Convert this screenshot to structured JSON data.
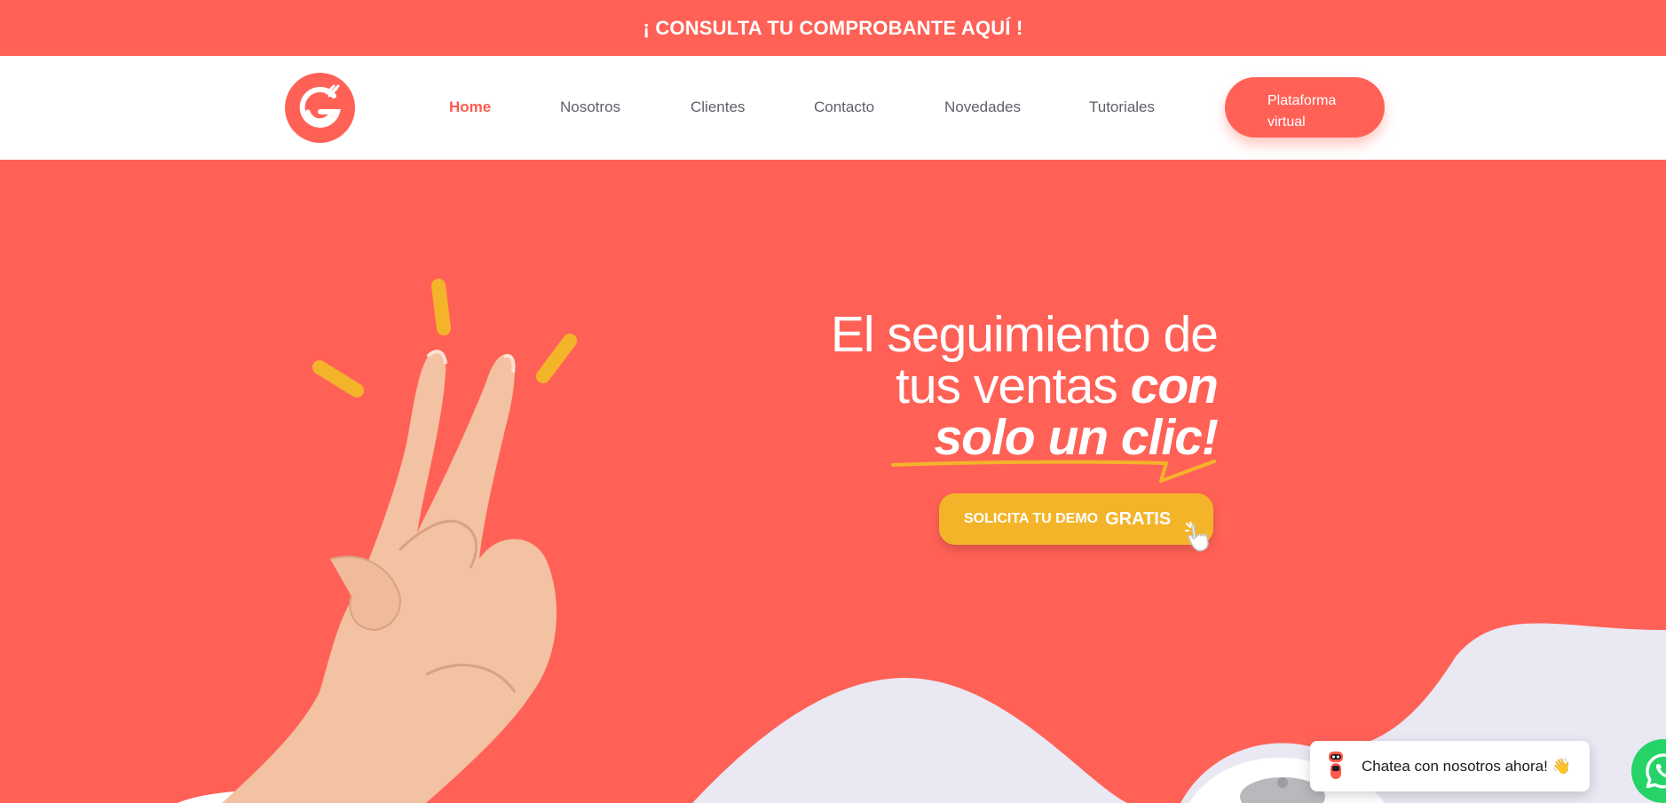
{
  "top_banner": {
    "text": "¡ CONSULTA TU COMPROBANTE AQUÍ !"
  },
  "nav": {
    "logo": "gestion-g-fork-logo",
    "items": [
      {
        "label": "Home",
        "active": true
      },
      {
        "label": "Nosotros",
        "active": false
      },
      {
        "label": "Clientes",
        "active": false
      },
      {
        "label": "Contacto",
        "active": false
      },
      {
        "label": "Novedades",
        "active": false
      },
      {
        "label": "Tutoriales",
        "active": false
      }
    ],
    "cta_line1": "Plataforma",
    "cta_line2": "virtual"
  },
  "hero": {
    "line1": "El seguimiento de",
    "line2_regular": "tus ventas ",
    "line2_emphasis": "con",
    "line3": "solo un clic!",
    "cta_small": "SOLICITA TU DEMO",
    "cta_big": "GRATIS"
  },
  "chat": {
    "text": "Chatea con nosotros ahora! 👋",
    "bot_icon": "robot-icon",
    "whatsapp_icon": "whatsapp-icon"
  },
  "colors": {
    "brand": "#ff6157",
    "accent_yellow": "#f4b42a",
    "wave": "#e9e8f3",
    "whatsapp": "#25d366"
  }
}
